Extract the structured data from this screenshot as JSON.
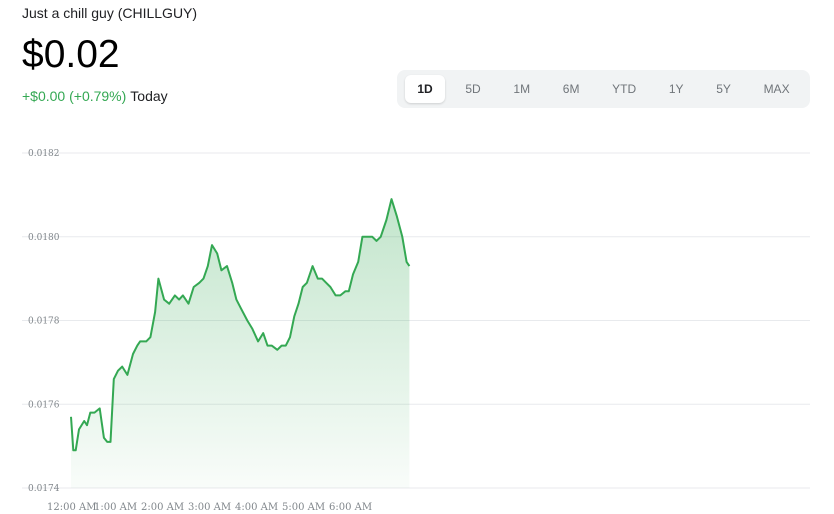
{
  "header": {
    "title": "Just a chill guy (CHILLGUY)",
    "price": "$0.02",
    "change": "+$0.00 (+0.79%)",
    "change_period": "Today"
  },
  "ranges": [
    {
      "label": "1D",
      "active": true
    },
    {
      "label": "5D",
      "active": false
    },
    {
      "label": "1M",
      "active": false
    },
    {
      "label": "6M",
      "active": false
    },
    {
      "label": "YTD",
      "active": false
    },
    {
      "label": "1Y",
      "active": false
    },
    {
      "label": "5Y",
      "active": false
    },
    {
      "label": "MAX",
      "active": false
    }
  ],
  "colors": {
    "line": "#34a853",
    "up_text": "#34a853",
    "grid": "#e8eaed"
  },
  "chart_data": {
    "type": "area",
    "ylim": [
      0.0174,
      0.0182
    ],
    "y_ticks": [
      "0.0182",
      "0.0180",
      "0.0178",
      "0.0176",
      "0.0174"
    ],
    "y_tick_values": [
      0.0182,
      0.018,
      0.0178,
      0.0176,
      0.0174
    ],
    "x_ticks": [
      "12:00 AM",
      "1:00 AM",
      "2:00 AM",
      "3:00 AM",
      "4:00 AM",
      "5:00 AM",
      "6:00 AM"
    ],
    "x_tick_values": [
      0,
      1,
      2,
      3,
      4,
      5,
      6
    ],
    "xlim": [
      0,
      16.8
    ],
    "grid": true,
    "series": [
      {
        "x": [
          0.0,
          0.05,
          0.1,
          0.17,
          0.28,
          0.34,
          0.41,
          0.5,
          0.61,
          0.7,
          0.77,
          0.84,
          0.91,
          1.0,
          1.09,
          1.2,
          1.32,
          1.41,
          1.47,
          1.6,
          1.69,
          1.79,
          1.86,
          1.98,
          2.09,
          2.21,
          2.3,
          2.38,
          2.5,
          2.61,
          2.73,
          2.82,
          2.91,
          3.0,
          3.11,
          3.2,
          3.32,
          3.43,
          3.52,
          3.61,
          3.75,
          3.86,
          3.98,
          4.09,
          4.18,
          4.27,
          4.39,
          4.48,
          4.57,
          4.66,
          4.75,
          4.84,
          4.93,
          5.02,
          5.14,
          5.25,
          5.34,
          5.43,
          5.52,
          5.63,
          5.73,
          5.84,
          5.91,
          6.0,
          6.11,
          6.2,
          6.32,
          6.41,
          6.5,
          6.59,
          6.71,
          6.82,
          6.93,
          7.05,
          7.14,
          7.2
        ],
        "values": [
          0.01757,
          0.01749,
          0.01749,
          0.01754,
          0.01756,
          0.01755,
          0.01758,
          0.01758,
          0.01759,
          0.01752,
          0.01751,
          0.01751,
          0.01766,
          0.01768,
          0.01769,
          0.01767,
          0.01772,
          0.01774,
          0.01775,
          0.01775,
          0.01776,
          0.01782,
          0.0179,
          0.01785,
          0.01784,
          0.01786,
          0.01785,
          0.01786,
          0.01784,
          0.01788,
          0.01789,
          0.0179,
          0.01793,
          0.01798,
          0.01796,
          0.01792,
          0.01793,
          0.01789,
          0.01785,
          0.01783,
          0.0178,
          0.01778,
          0.01775,
          0.01777,
          0.01774,
          0.01774,
          0.01773,
          0.01774,
          0.01774,
          0.01776,
          0.01781,
          0.01784,
          0.01788,
          0.01789,
          0.01793,
          0.0179,
          0.0179,
          0.01789,
          0.01788,
          0.01786,
          0.01786,
          0.01787,
          0.01787,
          0.01791,
          0.01794,
          0.018,
          0.018,
          0.018,
          0.01799,
          0.018,
          0.01804,
          0.01809,
          0.01805,
          0.018,
          0.01794,
          0.01793
        ]
      }
    ]
  }
}
